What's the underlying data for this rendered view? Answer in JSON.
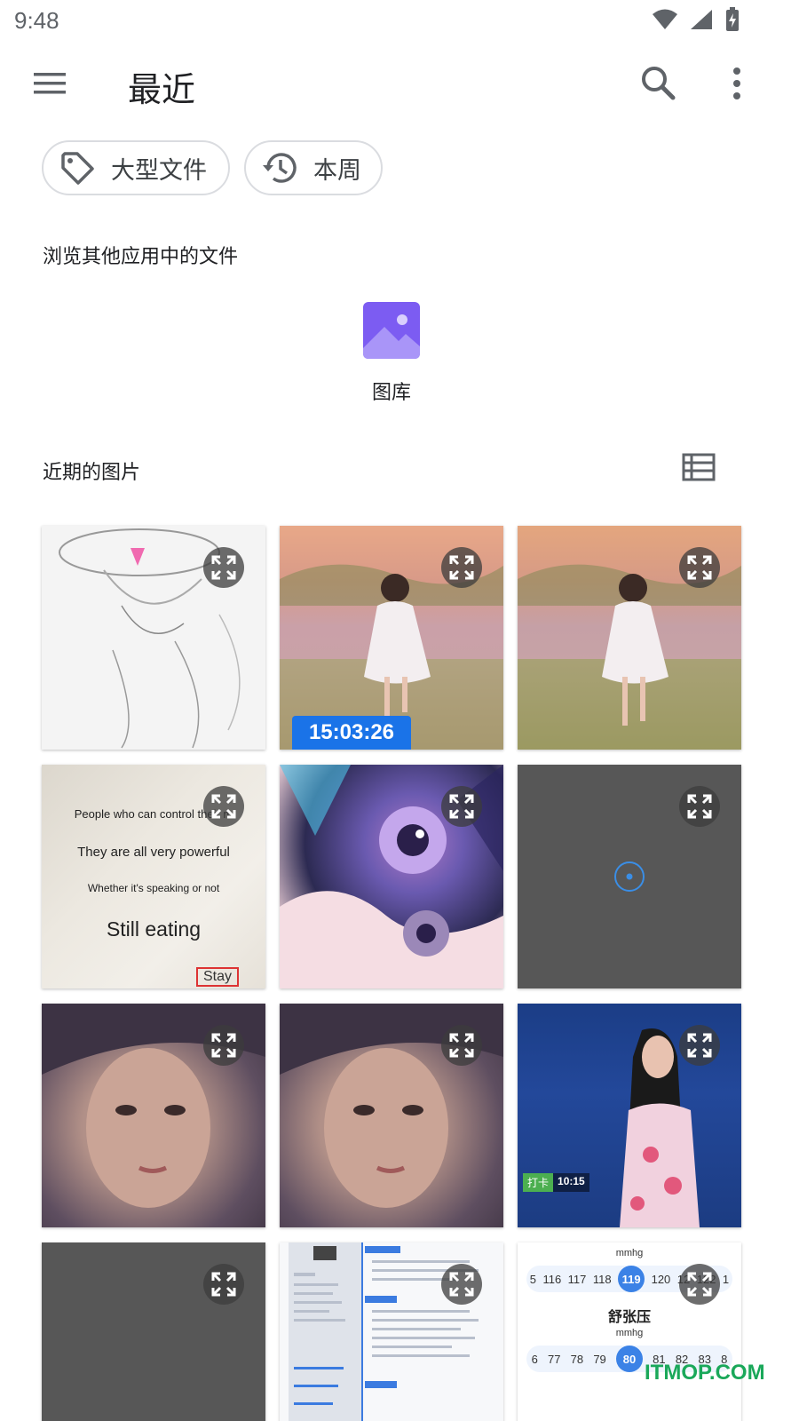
{
  "status_bar": {
    "time": "9:48"
  },
  "app_bar": {
    "title": "最近"
  },
  "chips": [
    {
      "label": "大型文件",
      "icon": "tag-icon"
    },
    {
      "label": "本周",
      "icon": "history-icon"
    }
  ],
  "browse_section": {
    "label": "浏览其他应用中的文件"
  },
  "apps": [
    {
      "label": "图库",
      "icon": "gallery-icon",
      "color": "#7c5cf2"
    }
  ],
  "recent_section": {
    "label": "近期的图片"
  },
  "thumbnails": {
    "t2_timestamp": "15:03:26",
    "t4_quote": {
      "line1": "People who can control their m",
      "line2": "They are all very powerful",
      "line3": "Whether it's speaking or not",
      "line4": "Still eating",
      "tag": "Stay"
    },
    "t9_badge": {
      "tag": "打卡",
      "time": "10:15"
    },
    "t12_chart": {
      "unit": "mmhg",
      "row1": [
        "5",
        "116",
        "117",
        "118",
        "119",
        "120",
        "12",
        "122",
        "1"
      ],
      "row1_selected": "119",
      "title": "舒张压",
      "row2": [
        "6",
        "77",
        "78",
        "79",
        "80",
        "81",
        "82",
        "83",
        "8"
      ],
      "row2_selected": "80"
    }
  },
  "watermark": "ITMOP.COM",
  "colors": {
    "accent": "#1a73e8",
    "chip_border": "#dadce0"
  }
}
